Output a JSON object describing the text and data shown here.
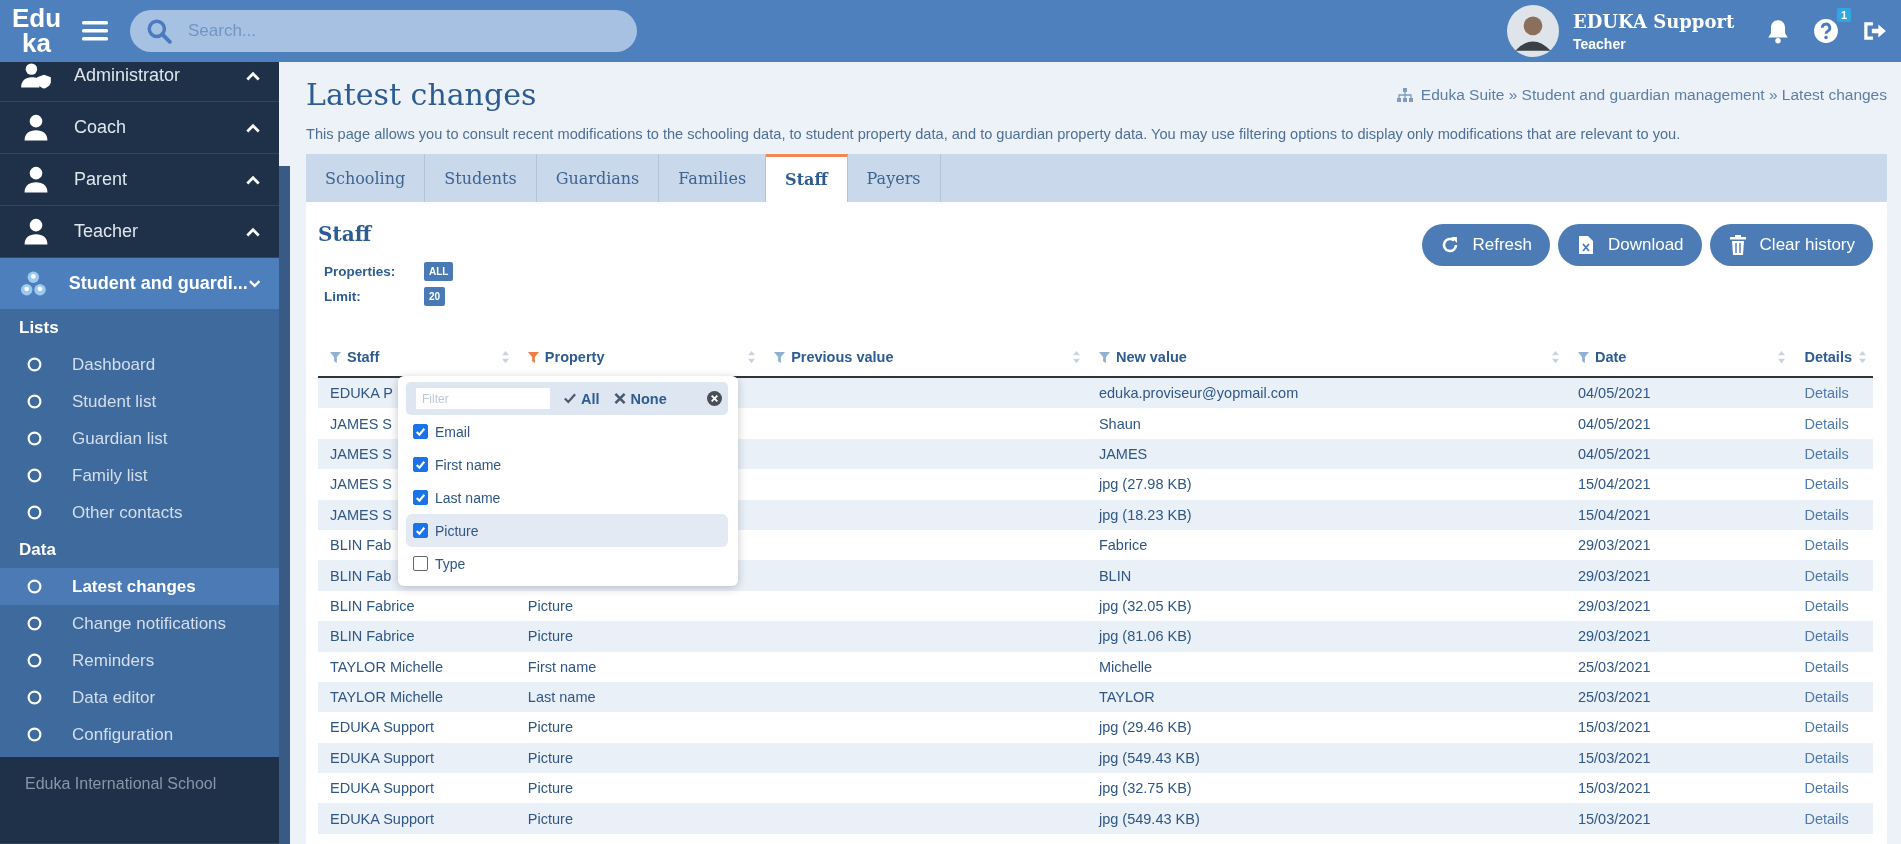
{
  "topbar": {
    "logo_lines": [
      "Edu",
      "ka"
    ],
    "search": {
      "placeholder": "Search..."
    },
    "user": {
      "name": "EDUKA Support",
      "role": "Teacher"
    },
    "help_badge": "1"
  },
  "sidebar": {
    "menu": [
      {
        "label": "Administrator",
        "kind": "admin",
        "expanded": false,
        "selected": false
      },
      {
        "label": "Coach",
        "kind": "person",
        "expanded": false,
        "selected": false
      },
      {
        "label": "Parent",
        "kind": "person",
        "expanded": false,
        "selected": false
      },
      {
        "label": "Teacher",
        "kind": "person",
        "expanded": false,
        "selected": false
      },
      {
        "label": "Student and guardi...",
        "kind": "group",
        "expanded": true,
        "selected": true
      }
    ],
    "groups": [
      {
        "heading": "Lists",
        "items": [
          {
            "label": "Dashboard",
            "selected": false
          },
          {
            "label": "Student list",
            "selected": false
          },
          {
            "label": "Guardian list",
            "selected": false
          },
          {
            "label": "Family list",
            "selected": false
          },
          {
            "label": "Other contacts",
            "selected": false
          }
        ]
      },
      {
        "heading": "Data",
        "items": [
          {
            "label": "Latest changes",
            "selected": true
          },
          {
            "label": "Change notifications",
            "selected": false
          },
          {
            "label": "Reminders",
            "selected": false
          },
          {
            "label": "Data editor",
            "selected": false
          },
          {
            "label": "Configuration",
            "selected": false
          }
        ]
      }
    ],
    "footer": "Eduka International School"
  },
  "page": {
    "title": "Latest changes",
    "breadcrumb": "Eduka Suite » Student and guardian management » Latest changes",
    "description": "This page allows you to consult recent modifications to the schooling data, to student property data, and to guardian property data. You may use filtering options to display only modifications that are relevant to you."
  },
  "tabs": [
    {
      "label": "Schooling",
      "selected": false
    },
    {
      "label": "Students",
      "selected": false
    },
    {
      "label": "Guardians",
      "selected": false
    },
    {
      "label": "Families",
      "selected": false
    },
    {
      "label": "Staff",
      "selected": true
    },
    {
      "label": "Payers",
      "selected": false
    }
  ],
  "panel": {
    "title": "Staff",
    "buttons": [
      {
        "label": "Refresh",
        "kind": "refresh"
      },
      {
        "label": "Download",
        "kind": "excel"
      },
      {
        "label": "Clear history",
        "kind": "trash"
      }
    ],
    "filters": [
      {
        "label": "Properties:",
        "value": "ALL"
      },
      {
        "label": "Limit:",
        "value": "20"
      }
    ]
  },
  "table": {
    "columns": [
      {
        "label": "Staff",
        "filter_active": false
      },
      {
        "label": "Property",
        "filter_active": true
      },
      {
        "label": "Previous value",
        "filter_active": false
      },
      {
        "label": "New value",
        "filter_active": false
      },
      {
        "label": "Date",
        "filter_active": false
      },
      {
        "label": "Details"
      }
    ],
    "rows": [
      {
        "staff": "EDUKA P",
        "new_value": "eduka.proviseur@yopmail.com",
        "date": "04/05/2021",
        "details": "Details"
      },
      {
        "staff": "JAMES S",
        "new_value": "Shaun",
        "date": "04/05/2021",
        "details": "Details"
      },
      {
        "staff": "JAMES S",
        "new_value": "JAMES",
        "date": "04/05/2021",
        "details": "Details"
      },
      {
        "staff": "JAMES S",
        "new_value": "jpg (27.98 KB)",
        "date": "15/04/2021",
        "details": "Details"
      },
      {
        "staff": "JAMES S",
        "new_value": "jpg (18.23 KB)",
        "date": "15/04/2021",
        "details": "Details"
      },
      {
        "staff": "BLIN Fab",
        "new_value": "Fabrice",
        "date": "29/03/2021",
        "details": "Details"
      },
      {
        "staff": "BLIN Fab",
        "new_value": "BLIN",
        "date": "29/03/2021",
        "details": "Details"
      },
      {
        "staff": "BLIN Fabrice",
        "property": "Picture",
        "new_value": "jpg (32.05 KB)",
        "date": "29/03/2021",
        "details": "Details"
      },
      {
        "staff": "BLIN Fabrice",
        "property": "Picture",
        "new_value": "jpg (81.06 KB)",
        "date": "29/03/2021",
        "details": "Details"
      },
      {
        "staff": "TAYLOR Michelle",
        "property": "First name",
        "new_value": "Michelle",
        "date": "25/03/2021",
        "details": "Details"
      },
      {
        "staff": "TAYLOR Michelle",
        "property": "Last name",
        "new_value": "TAYLOR",
        "date": "25/03/2021",
        "details": "Details"
      },
      {
        "staff": "EDUKA Support",
        "property": "Picture",
        "new_value": "jpg (29.46 KB)",
        "date": "15/03/2021",
        "details": "Details"
      },
      {
        "staff": "EDUKA Support",
        "property": "Picture",
        "new_value": "jpg (549.43 KB)",
        "date": "15/03/2021",
        "details": "Details"
      },
      {
        "staff": "EDUKA Support",
        "property": "Picture",
        "new_value": "jpg (32.75 KB)",
        "date": "15/03/2021",
        "details": "Details"
      },
      {
        "staff": "EDUKA Support",
        "property": "Picture",
        "new_value": "jpg (549.43 KB)",
        "date": "15/03/2021",
        "details": "Details"
      }
    ]
  },
  "filter_dropdown": {
    "placeholder": "Filter",
    "all": "All",
    "none": "None",
    "options": [
      {
        "label": "Email",
        "checked": true,
        "selected": false
      },
      {
        "label": "First name",
        "checked": true,
        "selected": false
      },
      {
        "label": "Last name",
        "checked": true,
        "selected": false
      },
      {
        "label": "Picture",
        "checked": true,
        "selected": true
      },
      {
        "label": "Type",
        "checked": false,
        "selected": false
      }
    ]
  }
}
